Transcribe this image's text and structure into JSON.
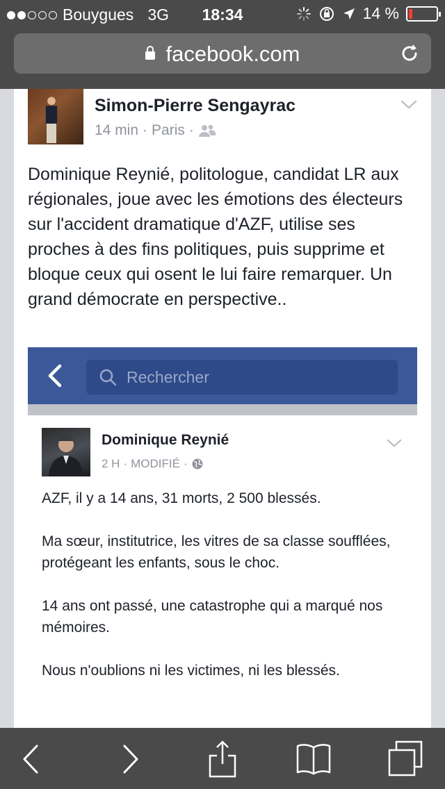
{
  "status_bar": {
    "carrier": "Bouygues",
    "network": "3G",
    "time": "18:34",
    "battery": "14 %",
    "battery_level": 0.14,
    "signal_bars": 2,
    "icons": [
      "signal-dots",
      "loading-spinner-icon",
      "orientation-lock-icon",
      "location-arrow-icon",
      "battery-icon"
    ]
  },
  "url_bar": {
    "url": "facebook.com",
    "icons": [
      "lock-icon",
      "reload-icon"
    ]
  },
  "post": {
    "author": "Simon-Pierre Sengayrac",
    "time": "14 min",
    "location": "Paris",
    "audience_icon": "friends-icon",
    "text": "Dominique Reynié, politologue, candidat LR aux régionales, joue avec les émotions des électeurs sur l'accident dramatique d'AZF, utilise ses proches à des fins politiques, puis supprime et bloque ceux qui osent le lui faire remarquer. Un grand démocrate en perspective.."
  },
  "embedded": {
    "search_placeholder": "Rechercher",
    "author": "Dominique Reynié",
    "time": "2 H",
    "modified": "MODIFIÉ",
    "audience_icon": "globe-icon",
    "paragraphs": [
      "AZF, il y a 14 ans, 31 morts, 2 500 blessés.",
      "Ma sœur, institutrice, les vitres de sa classe soufflées, protégeant les enfants, sous le choc.",
      "14 ans ont passé, une catastrophe qui a marqué nos mémoires.",
      "Nous n'oublions ni les victimes, ni les blessés."
    ]
  },
  "toolbar": {
    "icons": [
      "back-icon",
      "forward-icon",
      "share-icon",
      "bookmarks-icon",
      "tabs-icon"
    ]
  },
  "colors": {
    "facebook_blue": "#3b5998",
    "chrome": "#4a4a4a",
    "text": "#1d2129",
    "meta": "#90949c",
    "battery_low": "#ff3b30"
  }
}
